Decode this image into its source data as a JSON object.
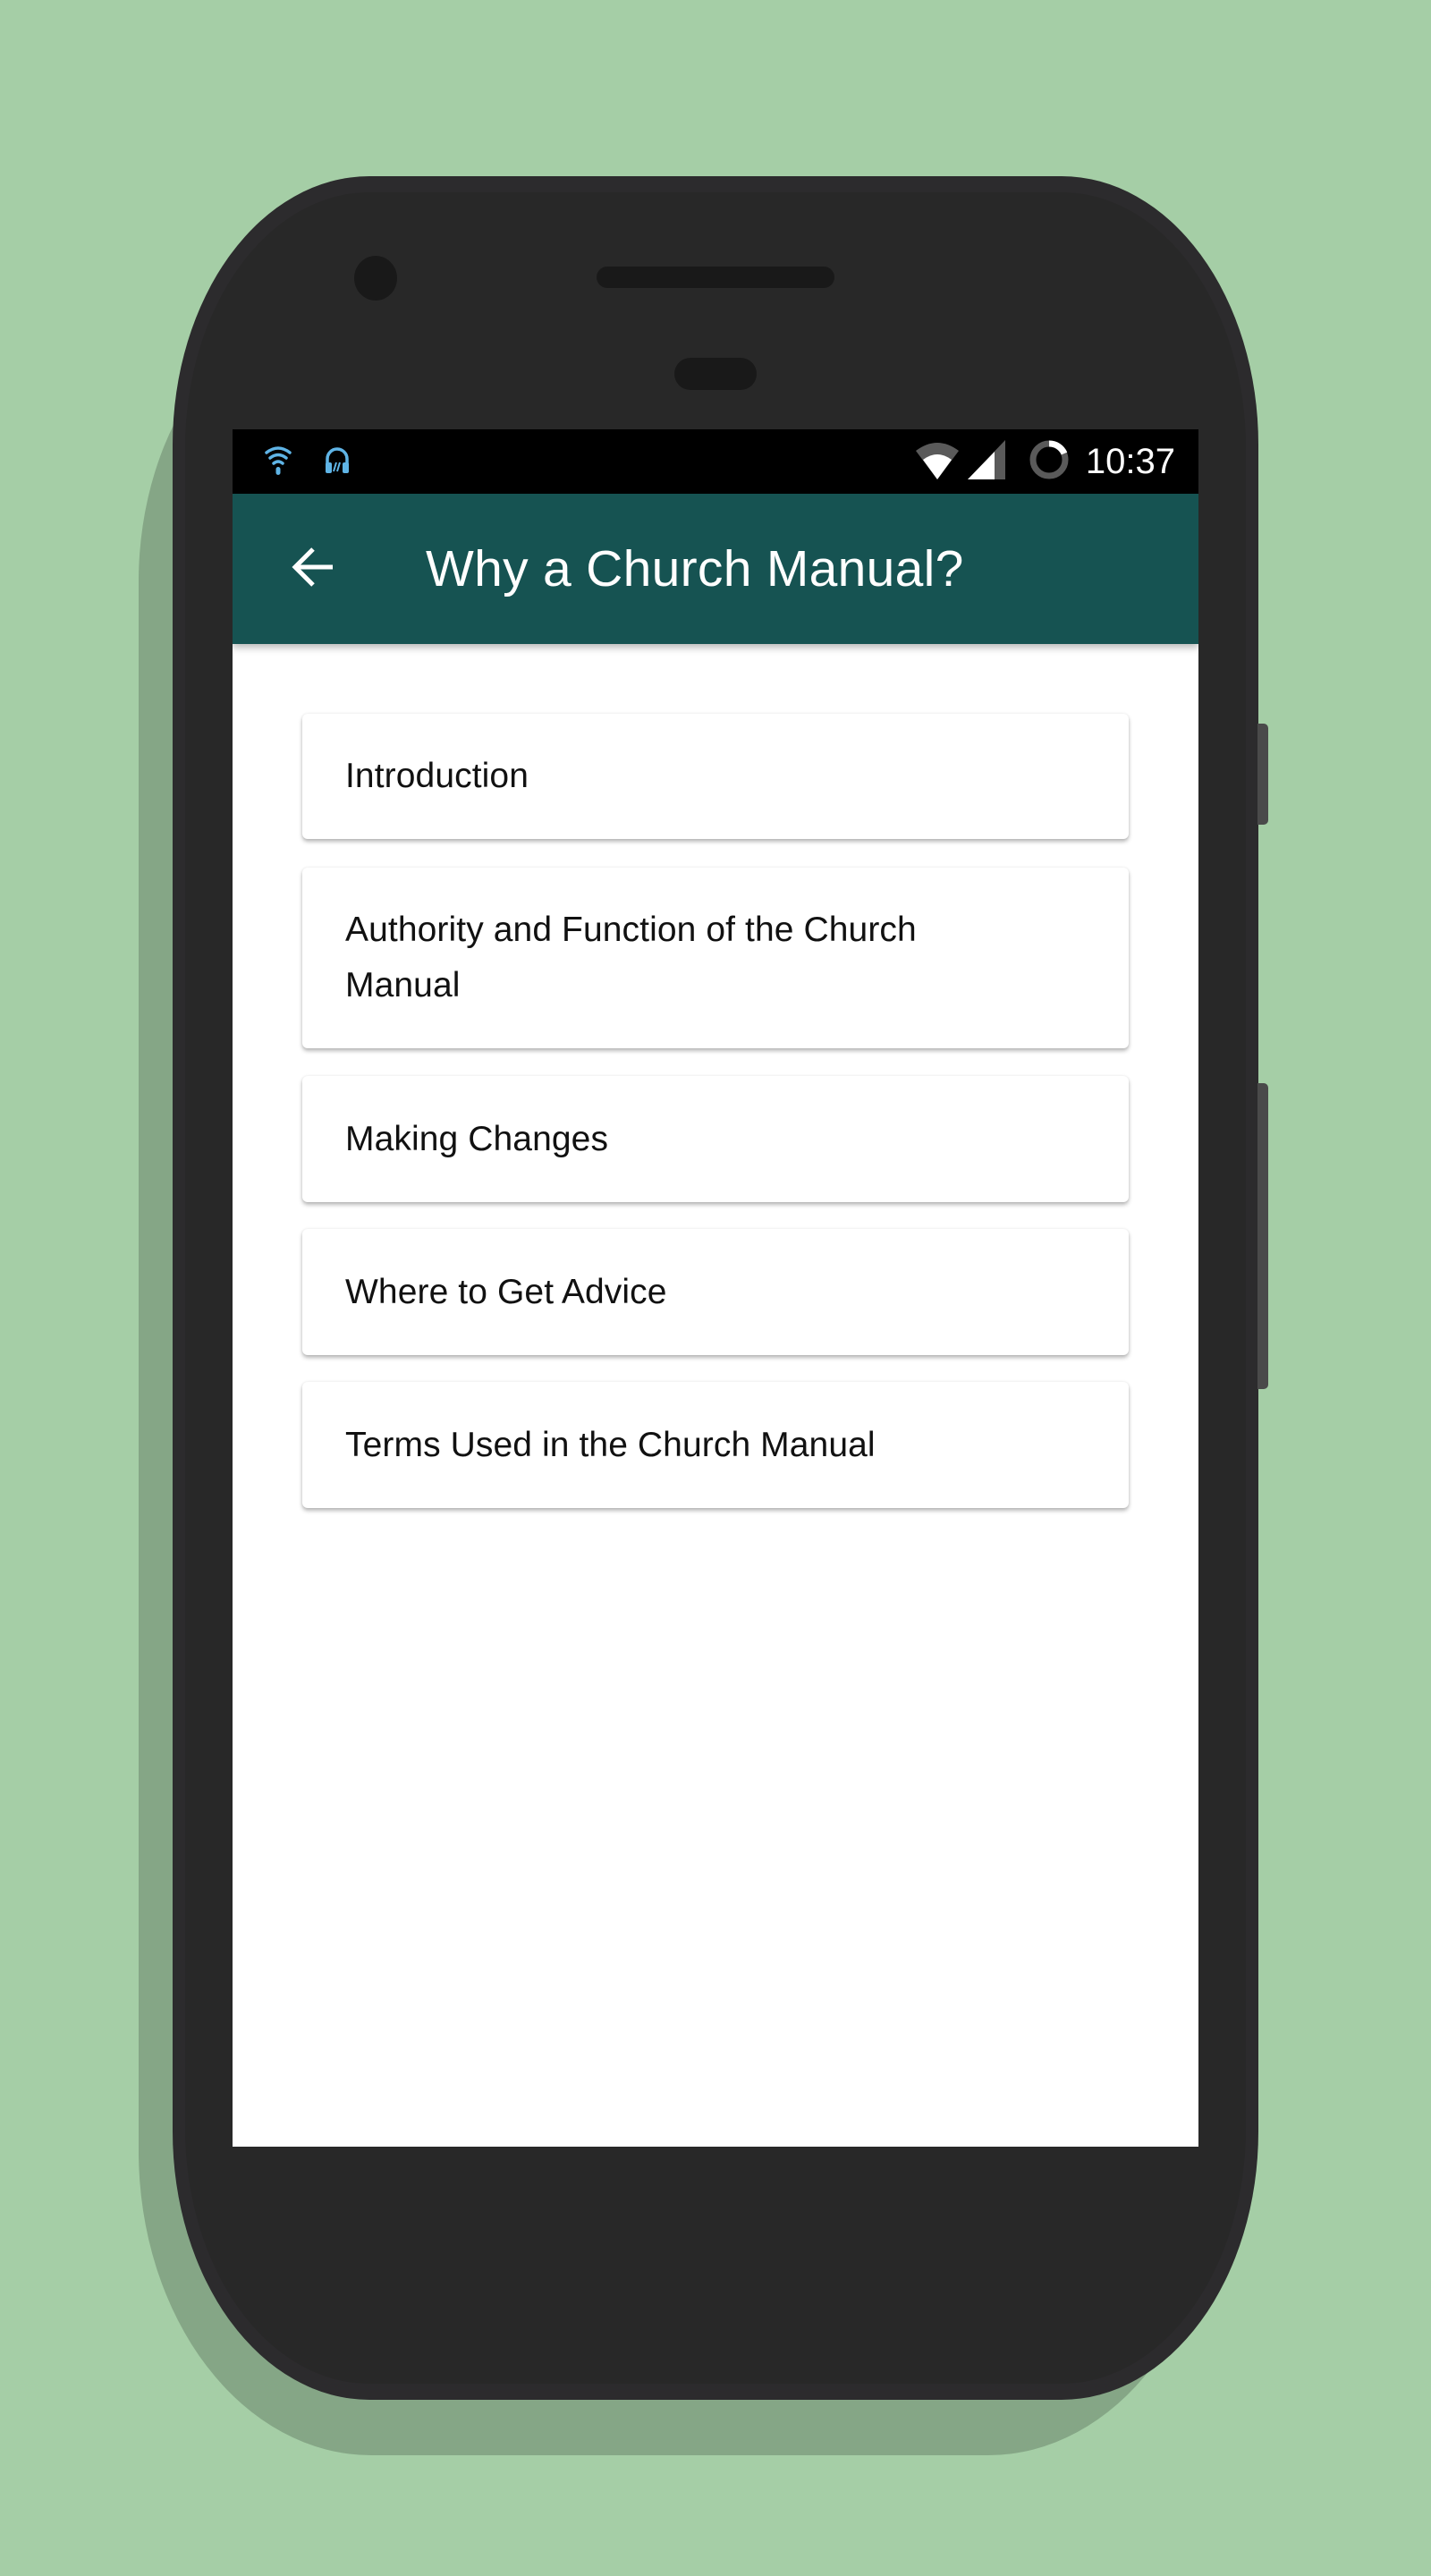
{
  "status_bar": {
    "left_icons": [
      "wifi-icon",
      "headset-icon"
    ],
    "right_icons": [
      "wifi-signal-icon",
      "cell-signal-icon",
      "battery-charging-icon"
    ],
    "time": "10:37"
  },
  "app_bar": {
    "back_icon": "arrow-left-icon",
    "title": "Why a Church Manual?"
  },
  "colors": {
    "app_bar": "#165352",
    "background": "#a5cea6",
    "status_icon_accent": "#5fb4e6"
  },
  "sections": [
    {
      "label": "Introduction"
    },
    {
      "label": "Authority and Function of the Church Manual"
    },
    {
      "label": "Making Changes"
    },
    {
      "label": "Where to Get Advice"
    },
    {
      "label": "Terms Used in the Church Manual"
    }
  ]
}
